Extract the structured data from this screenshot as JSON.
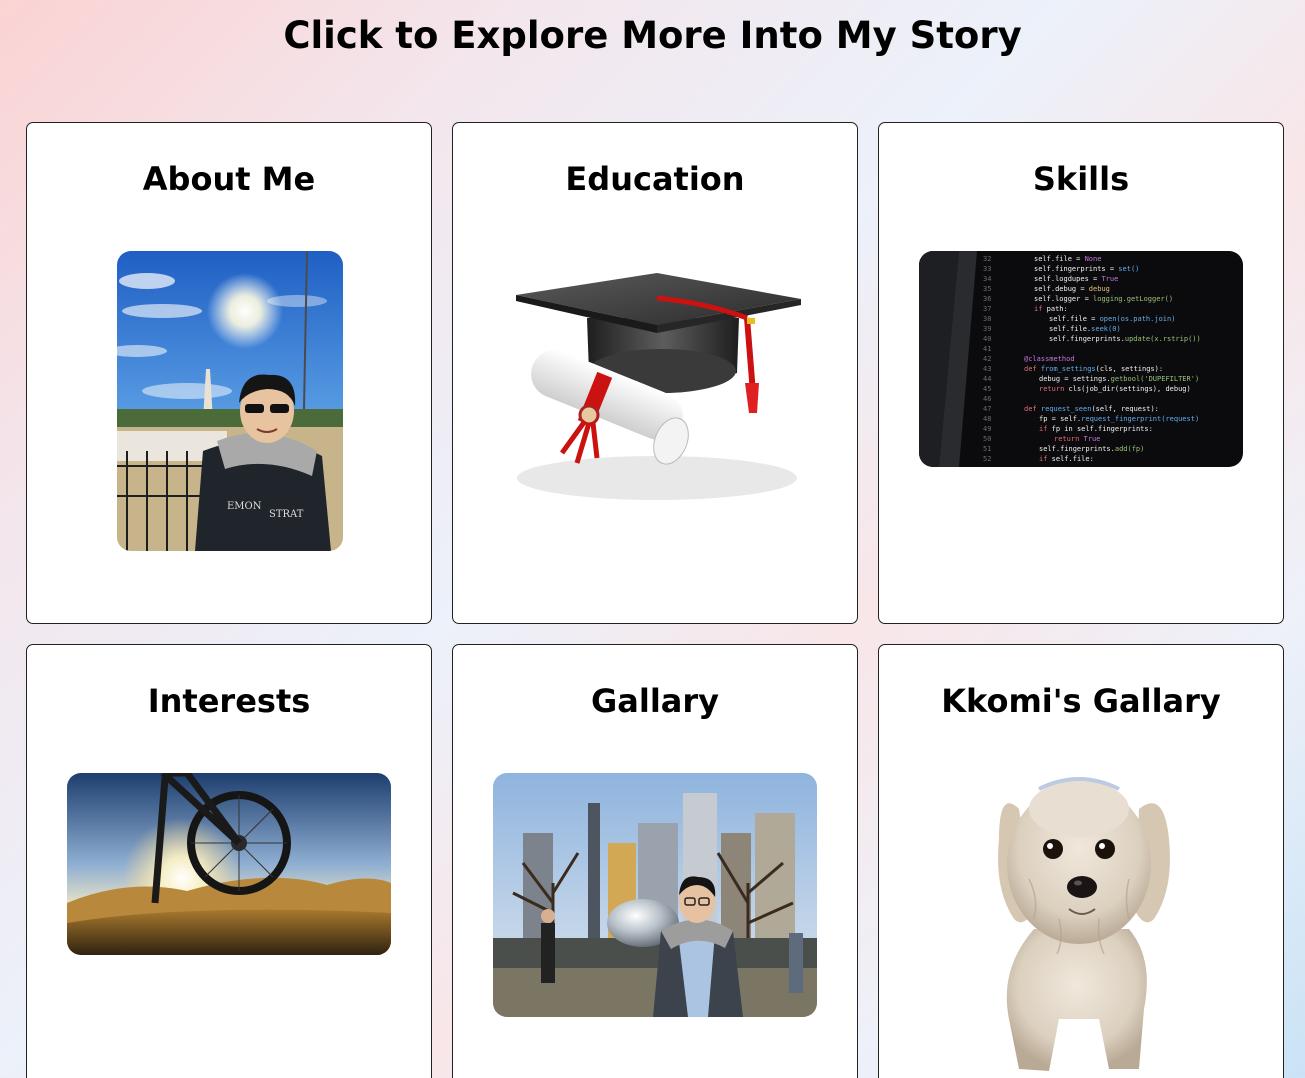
{
  "page": {
    "title": "Click to Explore More Into My Story"
  },
  "cards": [
    {
      "title": "About Me",
      "image": "photo-person-washington-monument-icon"
    },
    {
      "title": "Education",
      "image": "graduation-cap-diploma-icon"
    },
    {
      "title": "Skills",
      "image": "code-screen-icon"
    },
    {
      "title": "Interests",
      "image": "mountain-bike-icon"
    },
    {
      "title": "Gallary",
      "image": "photo-person-chicago-bean-icon"
    },
    {
      "title": "Kkomi's Gallary",
      "image": "white-dog-icon"
    }
  ]
}
